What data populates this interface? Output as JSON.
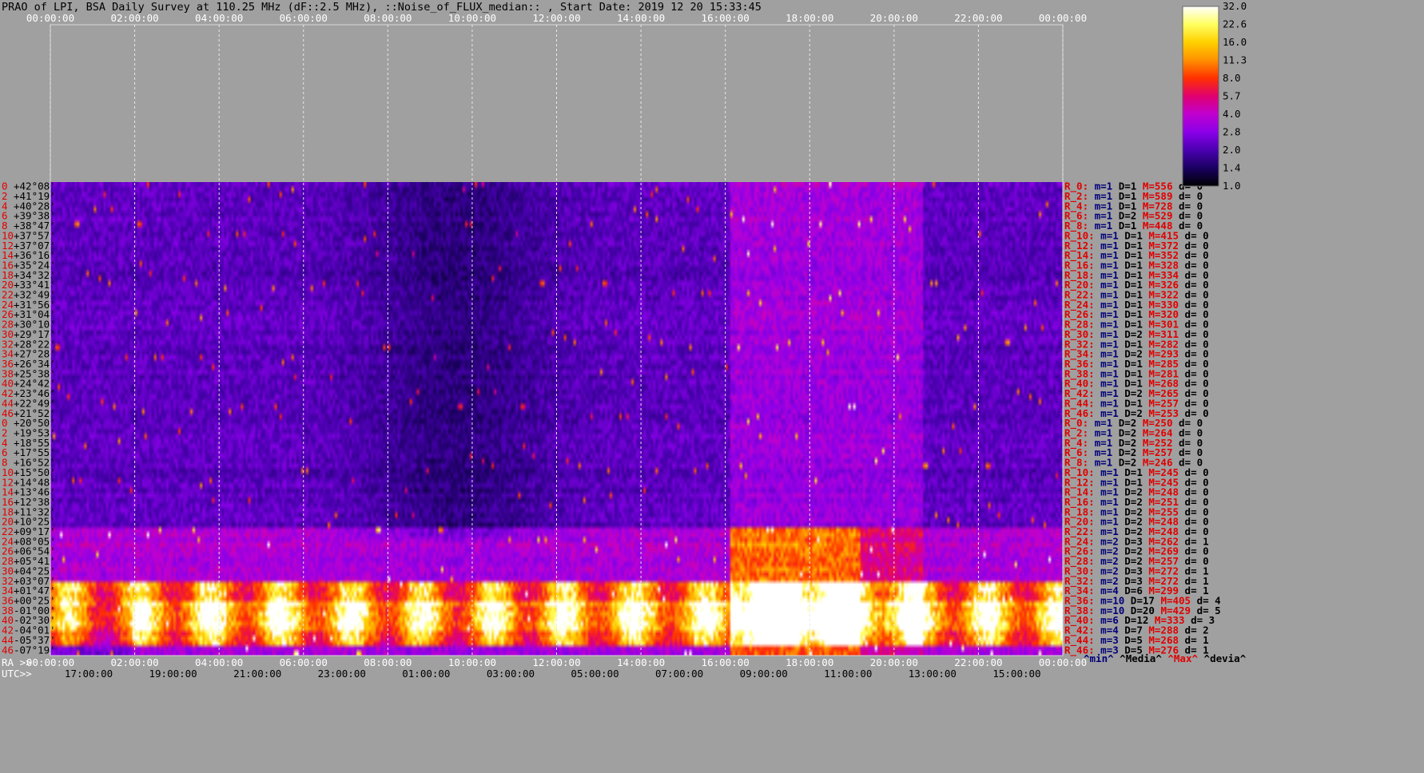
{
  "title": "PRAO of LPI, BSA Daily Survey at 110.25 MHz (dF::2.5 MHz), ::Noise_of_FLUX_median:: , Start Date: 2019 12 20 15:33:45",
  "chart_data": {
    "type": "heatmap",
    "top_axis_ticks": [
      "00:00:00",
      "02:00:00",
      "04:00:00",
      "06:00:00",
      "08:00:00",
      "10:00:00",
      "12:00:00",
      "14:00:00",
      "16:00:00",
      "18:00:00",
      "20:00:00",
      "22:00:00",
      "00:00:00"
    ],
    "ra_axis_label": "RA >>",
    "ra_axis_ticks": [
      "00:00:00",
      "02:00:00",
      "04:00:00",
      "06:00:00",
      "08:00:00",
      "10:00:00",
      "12:00:00",
      "14:00:00",
      "16:00:00",
      "18:00:00",
      "20:00:00",
      "22:00:00",
      "00:00:00"
    ],
    "utc_axis_label": "UTC>>",
    "utc_axis_ticks": [
      "17:00:00",
      "19:00:00",
      "21:00:00",
      "23:00:00",
      "01:00:00",
      "03:00:00",
      "05:00:00",
      "07:00:00",
      "09:00:00",
      "11:00:00",
      "13:00:00",
      "15:00:00"
    ],
    "colorbar_ticks": [
      "32.0",
      "22.6",
      "16.0",
      "11.3",
      "8.0",
      "5.7",
      "4.0",
      "2.8",
      "2.0",
      "1.4",
      "1.0"
    ],
    "colorbar_colors": [
      "#ffffff",
      "#ffff60",
      "#ffd000",
      "#ff9000",
      "#ff3000",
      "#e00070",
      "#c000d0",
      "#8a00e8",
      "#4a00b0",
      "#1a0060",
      "#000000"
    ],
    "row_numbers": [
      "0",
      "2",
      "4",
      "6",
      "8",
      "10",
      "12",
      "14",
      "16",
      "18",
      "20",
      "22",
      "24",
      "26",
      "28",
      "30",
      "32",
      "34",
      "36",
      "38",
      "40",
      "42",
      "44",
      "46",
      "0",
      "2",
      "4",
      "6",
      "8",
      "10",
      "12",
      "14",
      "16",
      "18",
      "20",
      "22",
      "24",
      "26",
      "28",
      "30",
      "32",
      "34",
      "36",
      "38",
      "40",
      "42",
      "44",
      "46"
    ],
    "dec_labels": [
      "+42°08'",
      "+41°19'",
      "+40°28'",
      "+39°38'",
      "+38°47'",
      "+37°57'",
      "+37°07'",
      "+36°16'",
      "+35°24'",
      "+34°32'",
      "+33°41'",
      "+32°49'",
      "+31°56'",
      "+31°04'",
      "+30°10'",
      "+29°17'",
      "+28°22'",
      "+27°28'",
      "+26°34'",
      "+25°38'",
      "+24°42'",
      "+23°46'",
      "+22°49'",
      "+21°52'",
      "+20°50'",
      "+19°53'",
      "+18°55'",
      "+17°55'",
      "+16°52'",
      "+15°50'",
      "+14°48'",
      "+13°46'",
      "+12°38'",
      "+11°32'",
      "+10°25'",
      "+09°17'",
      "+08°05'",
      "+06°54'",
      "+05°41'",
      "+04°25'",
      "+03°07'",
      "+01°47'",
      "+00°25'",
      "-01°00'",
      "-02°30'",
      "-04°01'",
      "-05°37'",
      "-07°19'"
    ],
    "beam_stats": [
      {
        "r": "R_0:",
        "m": "m=1",
        "D": "D=1",
        "M": "M=556",
        "d": "d= 0"
      },
      {
        "r": "R_2:",
        "m": "m=1",
        "D": "D=1",
        "M": "M=589",
        "d": "d= 0"
      },
      {
        "r": "R_4:",
        "m": "m=1",
        "D": "D=1",
        "M": "M=728",
        "d": "d= 0"
      },
      {
        "r": "R_6:",
        "m": "m=1",
        "D": "D=2",
        "M": "M=529",
        "d": "d= 0"
      },
      {
        "r": "R_8:",
        "m": "m=1",
        "D": "D=1",
        "M": "M=448",
        "d": "d= 0"
      },
      {
        "r": "R_10:",
        "m": "m=1",
        "D": "D=1",
        "M": "M=415",
        "d": "d= 0"
      },
      {
        "r": "R_12:",
        "m": "m=1",
        "D": "D=1",
        "M": "M=372",
        "d": "d= 0"
      },
      {
        "r": "R_14:",
        "m": "m=1",
        "D": "D=1",
        "M": "M=352",
        "d": "d= 0"
      },
      {
        "r": "R_16:",
        "m": "m=1",
        "D": "D=1",
        "M": "M=328",
        "d": "d= 0"
      },
      {
        "r": "R_18:",
        "m": "m=1",
        "D": "D=1",
        "M": "M=334",
        "d": "d= 0"
      },
      {
        "r": "R_20:",
        "m": "m=1",
        "D": "D=1",
        "M": "M=326",
        "d": "d= 0"
      },
      {
        "r": "R_22:",
        "m": "m=1",
        "D": "D=1",
        "M": "M=322",
        "d": "d= 0"
      },
      {
        "r": "R_24:",
        "m": "m=1",
        "D": "D=1",
        "M": "M=330",
        "d": "d= 0"
      },
      {
        "r": "R_26:",
        "m": "m=1",
        "D": "D=1",
        "M": "M=320",
        "d": "d= 0"
      },
      {
        "r": "R_28:",
        "m": "m=1",
        "D": "D=1",
        "M": "M=301",
        "d": "d= 0"
      },
      {
        "r": "R_30:",
        "m": "m=1",
        "D": "D=2",
        "M": "M=311",
        "d": "d= 0"
      },
      {
        "r": "R_32:",
        "m": "m=1",
        "D": "D=1",
        "M": "M=282",
        "d": "d= 0"
      },
      {
        "r": "R_34:",
        "m": "m=1",
        "D": "D=2",
        "M": "M=293",
        "d": "d= 0"
      },
      {
        "r": "R_36:",
        "m": "m=1",
        "D": "D=1",
        "M": "M=285",
        "d": "d= 0"
      },
      {
        "r": "R_38:",
        "m": "m=1",
        "D": "D=1",
        "M": "M=281",
        "d": "d= 0"
      },
      {
        "r": "R_40:",
        "m": "m=1",
        "D": "D=1",
        "M": "M=268",
        "d": "d= 0"
      },
      {
        "r": "R_42:",
        "m": "m=1",
        "D": "D=2",
        "M": "M=265",
        "d": "d= 0"
      },
      {
        "r": "R_44:",
        "m": "m=1",
        "D": "D=1",
        "M": "M=257",
        "d": "d= 0"
      },
      {
        "r": "R_46:",
        "m": "m=1",
        "D": "D=2",
        "M": "M=253",
        "d": "d= 0"
      },
      {
        "r": "R_0:",
        "m": "m=1",
        "D": "D=2",
        "M": "M=250",
        "d": "d= 0"
      },
      {
        "r": "R_2:",
        "m": "m=1",
        "D": "D=2",
        "M": "M=264",
        "d": "d= 0"
      },
      {
        "r": "R_4:",
        "m": "m=1",
        "D": "D=2",
        "M": "M=252",
        "d": "d= 0"
      },
      {
        "r": "R_6:",
        "m": "m=1",
        "D": "D=2",
        "M": "M=257",
        "d": "d= 0"
      },
      {
        "r": "R_8:",
        "m": "m=1",
        "D": "D=2",
        "M": "M=246",
        "d": "d= 0"
      },
      {
        "r": "R_10:",
        "m": "m=1",
        "D": "D=1",
        "M": "M=245",
        "d": "d= 0"
      },
      {
        "r": "R_12:",
        "m": "m=1",
        "D": "D=1",
        "M": "M=245",
        "d": "d= 0"
      },
      {
        "r": "R_14:",
        "m": "m=1",
        "D": "D=2",
        "M": "M=248",
        "d": "d= 0"
      },
      {
        "r": "R_16:",
        "m": "m=1",
        "D": "D=2",
        "M": "M=251",
        "d": "d= 0"
      },
      {
        "r": "R_18:",
        "m": "m=1",
        "D": "D=2",
        "M": "M=255",
        "d": "d= 0"
      },
      {
        "r": "R_20:",
        "m": "m=1",
        "D": "D=2",
        "M": "M=248",
        "d": "d= 0"
      },
      {
        "r": "R_22:",
        "m": "m=1",
        "D": "D=2",
        "M": "M=248",
        "d": "d= 0"
      },
      {
        "r": "R_24:",
        "m": "m=2",
        "D": "D=3",
        "M": "M=262",
        "d": "d= 1"
      },
      {
        "r": "R_26:",
        "m": "m=2",
        "D": "D=2",
        "M": "M=269",
        "d": "d= 0"
      },
      {
        "r": "R_28:",
        "m": "m=2",
        "D": "D=2",
        "M": "M=257",
        "d": "d= 0"
      },
      {
        "r": "R_30:",
        "m": "m=2",
        "D": "D=3",
        "M": "M=272",
        "d": "d= 1"
      },
      {
        "r": "R_32:",
        "m": "m=2",
        "D": "D=3",
        "M": "M=272",
        "d": "d= 1"
      },
      {
        "r": "R_34:",
        "m": "m=4",
        "D": "D=6",
        "M": "M=299",
        "d": "d= 1"
      },
      {
        "r": "R_36:",
        "m": "m=10",
        "D": "D=17",
        "M": "M=405",
        "d": "d= 4"
      },
      {
        "r": "R_38:",
        "m": "m=10",
        "D": "D=20",
        "M": "M=429",
        "d": "d= 5"
      },
      {
        "r": "R_40:",
        "m": "m=6",
        "D": "D=12",
        "M": "M=333",
        "d": "d= 3"
      },
      {
        "r": "R_42:",
        "m": "m=4",
        "D": "D=7",
        "M": "M=288",
        "d": "d= 2"
      },
      {
        "r": "R_44:",
        "m": "m=3",
        "D": "D=5",
        "M": "M=268",
        "d": "d= 1"
      },
      {
        "r": "R_46:",
        "m": "m=3",
        "D": "D=5",
        "M": "M=276",
        "d": "d= 1"
      }
    ],
    "footer_legend": {
      "min": "^min^",
      "media": "^Media^",
      "max": "^Max^",
      "devia": "^devia^"
    },
    "colors": {
      "label_red": "#e00000",
      "stat_navy": "#00007a",
      "text": "#000000",
      "background": "#a0a0a0"
    }
  }
}
